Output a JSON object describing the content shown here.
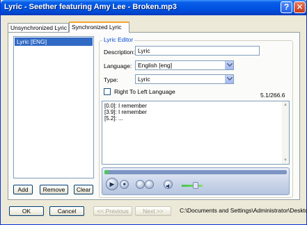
{
  "window": {
    "title": "Lyric - Seether featuring Amy Lee - Broken.mp3",
    "help_glyph": "?",
    "close_glyph": "✕"
  },
  "tabs": [
    {
      "label": "Unsynchronized Lyric"
    },
    {
      "label": "Synchronized Lyric"
    }
  ],
  "lyric_list": {
    "items": [
      "Lyric [ENG]"
    ]
  },
  "list_buttons": {
    "add": "Add",
    "remove": "Remove",
    "clear": "Clear"
  },
  "editor": {
    "group_title": "Lyric Editor",
    "description_label": "Description:",
    "description_value": "Lyric",
    "language_label": "Language:",
    "language_value": "English [eng]",
    "type_label": "Type:",
    "type_value": "Lyric",
    "rtl_label": "Right To Left Language",
    "rtl_checked": false,
    "position": "5.1/266.6",
    "lines": [
      "[0.0]: I remember",
      "[3.9]: I remember",
      "[5.2]: ..."
    ]
  },
  "player": {
    "seek_fraction": 0.02,
    "play_glyph": "▶",
    "stop_glyph": "■",
    "volume_fraction": 0.6
  },
  "footer": {
    "ok": "OK",
    "cancel": "Cancel",
    "previous": "<< Previous",
    "next": "Next >>",
    "path": "C:\\Documents and Settings\\Administrator\\Desktc"
  },
  "colors": {
    "titlebar": "#0054e3",
    "selection": "#316ac5",
    "active_tab_accent": "#f5a62d",
    "group_title": "#0046d5"
  }
}
